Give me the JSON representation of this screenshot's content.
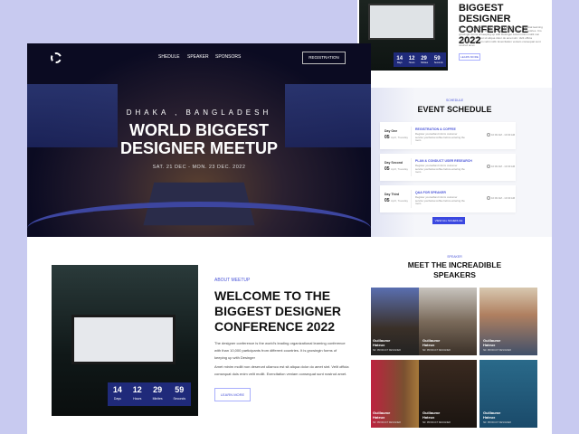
{
  "nav": {
    "items": [
      "SHEDULE",
      "SPEAKER",
      "SPONSORS"
    ],
    "register": "REGISTRATION"
  },
  "hero": {
    "location": "DHAKA , BANGLADESH",
    "title_line1": "WORLD BIGGEST",
    "title_line2": "DESIGNER MEETUP",
    "dates": "SAT. 21 DEC - MON. 23 DEC. 2022"
  },
  "about": {
    "label": "ABOUT MEETUP",
    "title": "WELCOME TO THE BIGGEST DESIGNER CONFERENCE 2022",
    "title_short": "BIGGEST DESIGNER CONFERENCE 2022",
    "p1": "The designer conference is the world's leading organizational learning conference with than 10,000 participants from different countries. It is growingin forms of keeping up with Desinger",
    "p2": "Amet minim mollit non deserunt ullamco est sit aliqua dolor do amet sint. Velit officia consequat duis enim velit mollit. Exercitation veniam consequat sunt nostrud amet.",
    "button": "LEARN MORE",
    "countdown": [
      {
        "value": "14",
        "unit": "Days"
      },
      {
        "value": "12",
        "unit": "Hours"
      },
      {
        "value": "29",
        "unit": "Minites"
      },
      {
        "value": "59",
        "unit": "Seconds"
      }
    ]
  },
  "schedule": {
    "label": "SCHEDULE",
    "title": "EVENT SCHEDULE",
    "button": "VIEW ALL SCHEDULE",
    "items": [
      {
        "day": "Day One",
        "date": "05",
        "date_sub": "April, Tuesday",
        "title": "REGISTRATION & COFFEE",
        "desc": "Register yourselfand inform customer service yourbelow.coffee before entering the room",
        "time": "10:00 AM - 10:30 AM"
      },
      {
        "day": "Day Second",
        "date": "05",
        "date_sub": "April, Tuesday",
        "title": "PLAN & CONDUCT USER RESEARCH",
        "desc": "Register yourselfand inform customer service yourbelow.coffee before entering the room",
        "time": "10:00 AM - 10:30 AM"
      },
      {
        "day": "Day Third",
        "date": "05",
        "date_sub": "April, Tuesday",
        "title": "Q&A FOR SPEAKER",
        "desc": "Register yourselfand inform customer service yourbelow.coffee before entering the room",
        "time": "10:00 AM - 10:30 AM"
      }
    ]
  },
  "speakers": {
    "label": "SPEAKER",
    "title_line1": "MEET THE INCREADIBLE",
    "title_line2": "SPEAKERS",
    "items": [
      {
        "name": "Guillaume Hateux",
        "role": "SR. PRODUCT DESIGNER"
      },
      {
        "name": "Guillaume Hateux",
        "role": "SR. PRODUCT DESIGNER"
      },
      {
        "name": "Guillaume Hateux",
        "role": "SR. PRODUCT DESIGNER"
      },
      {
        "name": "Guillaume Hateux",
        "role": "SR. PRODUCT DESIGNER"
      },
      {
        "name": "Guillaume Hateux",
        "role": "SR. PRODUCT DESIGNER"
      },
      {
        "name": "Guillaume Hateux",
        "role": "SR. PRODUCT DESIGNER"
      }
    ]
  },
  "colors": {
    "accent": "#3b48e0",
    "countdown": "#1f2a7a",
    "background": "#c8caf0"
  }
}
